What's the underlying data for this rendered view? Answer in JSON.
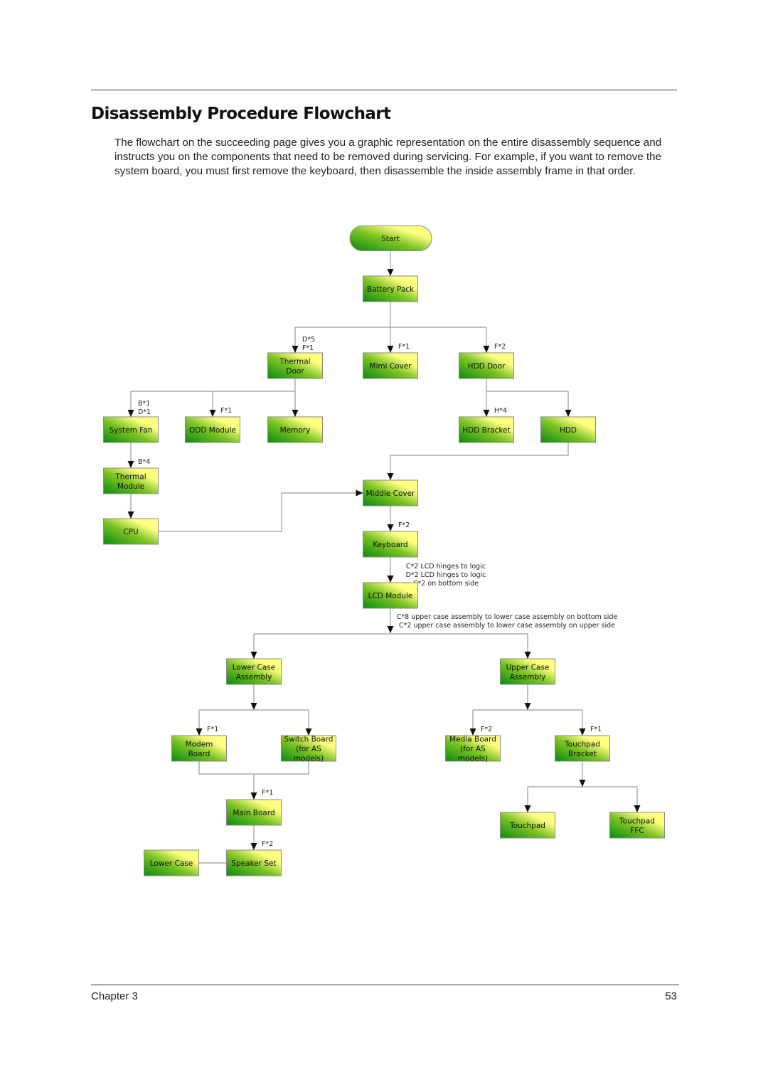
{
  "page": {
    "title": "Disassembly Procedure Flowchart",
    "intro": "The flowchart on the succeeding page gives you a graphic representation on the entire disassembly sequence and instructs you on the components that need to be removed during servicing. For example, if you want to remove the system board, you must first remove the keyboard, then disassemble the inside assembly frame in that order.",
    "footer_left": "Chapter 3",
    "footer_right": "53"
  },
  "colors": {
    "node_dark": "#0a8a10",
    "node_light": "#ffff80",
    "edge": "#9a9a9a",
    "arrow": "#111111"
  },
  "flowchart": {
    "nodes": [
      {
        "id": "start",
        "lines": [
          "Start"
        ],
        "shape": "terminator"
      },
      {
        "id": "battery",
        "lines": [
          "Battery Pack"
        ]
      },
      {
        "id": "thermaldoor",
        "lines": [
          "Thermal",
          "Door"
        ]
      },
      {
        "id": "mimicover",
        "lines": [
          "Mimi Cover"
        ]
      },
      {
        "id": "hdddoor",
        "lines": [
          "HDD Door"
        ]
      },
      {
        "id": "sysfan",
        "lines": [
          "System Fan"
        ]
      },
      {
        "id": "odd",
        "lines": [
          "ODD Module"
        ]
      },
      {
        "id": "memory",
        "lines": [
          "Memory"
        ]
      },
      {
        "id": "hddbracket",
        "lines": [
          "HDD Bracket"
        ]
      },
      {
        "id": "hdd",
        "lines": [
          "HDD"
        ]
      },
      {
        "id": "thermalmod",
        "lines": [
          "Thermal",
          "Module"
        ]
      },
      {
        "id": "cpu",
        "lines": [
          "CPU"
        ]
      },
      {
        "id": "middlecover",
        "lines": [
          "Middle Cover"
        ]
      },
      {
        "id": "keyboard",
        "lines": [
          "Keyboard"
        ]
      },
      {
        "id": "lcd",
        "lines": [
          "LCD Module"
        ]
      },
      {
        "id": "lowercaseasm",
        "lines": [
          "Lower Case",
          "Assembly"
        ]
      },
      {
        "id": "uppercaseasm",
        "lines": [
          "Upper Case",
          "Assembly"
        ]
      },
      {
        "id": "modem",
        "lines": [
          "Modem",
          "Board"
        ]
      },
      {
        "id": "switchboard",
        "lines": [
          "Switch Board",
          "(for AS",
          "models)"
        ]
      },
      {
        "id": "mediaboard",
        "lines": [
          "Media Board",
          "(for AS",
          "models)"
        ]
      },
      {
        "id": "tpbracket",
        "lines": [
          "Touchpad",
          "Bracket"
        ]
      },
      {
        "id": "mainboard",
        "lines": [
          "Main Board"
        ]
      },
      {
        "id": "touchpad",
        "lines": [
          "Touchpad"
        ]
      },
      {
        "id": "tpffc",
        "lines": [
          "Touchpad",
          "FFC"
        ]
      },
      {
        "id": "lowercase",
        "lines": [
          "Lower Case"
        ]
      },
      {
        "id": "speaker",
        "lines": [
          "Speaker Set"
        ]
      }
    ],
    "edges": [
      {
        "from": "start",
        "to": "battery",
        "label": []
      },
      {
        "from": "battery",
        "to": "thermaldoor",
        "label": [
          "D*5",
          "F*1"
        ]
      },
      {
        "from": "battery",
        "to": "mimicover",
        "label": [
          "F*1"
        ]
      },
      {
        "from": "battery",
        "to": "hdddoor",
        "label": [
          "F*2"
        ]
      },
      {
        "from": "thermaldoor",
        "to": "sysfan",
        "label": [
          "B*1",
          "D*1"
        ]
      },
      {
        "from": "thermaldoor",
        "to": "odd",
        "label": [
          "F*1"
        ]
      },
      {
        "from": "thermaldoor",
        "to": "memory",
        "label": []
      },
      {
        "from": "hdddoor",
        "to": "hddbracket",
        "label": [
          "H*4"
        ]
      },
      {
        "from": "hdddoor",
        "to": "hdd",
        "label": []
      },
      {
        "from": "sysfan",
        "to": "thermalmod",
        "label": [
          "B*4"
        ]
      },
      {
        "from": "thermalmod",
        "to": "cpu",
        "label": []
      },
      {
        "from": "cpu",
        "to": "middlecover",
        "label": []
      },
      {
        "from": "hdd",
        "to": "middlecover",
        "label": []
      },
      {
        "from": "middlecover",
        "to": "keyboard",
        "label": [
          "F*2"
        ]
      },
      {
        "from": "keyboard",
        "to": "lcd",
        "label": [
          "C*2 LCD hinges to logic",
          "D*2 LCD hinges to logic",
          "C*2 on bottom side"
        ]
      },
      {
        "from": "lcd",
        "to": "lowercaseasm",
        "label": [
          "C*8 upper case assembly to lower case assembly on bottom side",
          "C*2 upper case assembly to lower case assembly on upper side"
        ]
      },
      {
        "from": "lcd",
        "to": "uppercaseasm",
        "label": []
      },
      {
        "from": "lowercaseasm",
        "to": "modem",
        "label": [
          "F*1"
        ]
      },
      {
        "from": "lowercaseasm",
        "to": "switchboard",
        "label": []
      },
      {
        "from": "uppercaseasm",
        "to": "mediaboard",
        "label": [
          "F*2"
        ]
      },
      {
        "from": "uppercaseasm",
        "to": "tpbracket",
        "label": [
          "F*1"
        ]
      },
      {
        "from": "modem",
        "to": "mainboard",
        "label": [
          "F*1"
        ]
      },
      {
        "from": "switchboard",
        "to": "mainboard",
        "label": []
      },
      {
        "from": "tpbracket",
        "to": "touchpad",
        "label": []
      },
      {
        "from": "tpbracket",
        "to": "tpffc",
        "label": []
      },
      {
        "from": "mainboard",
        "to": "speaker",
        "label": [
          "F*2"
        ]
      },
      {
        "from": "lowercase",
        "to": "speaker",
        "label": []
      }
    ]
  }
}
